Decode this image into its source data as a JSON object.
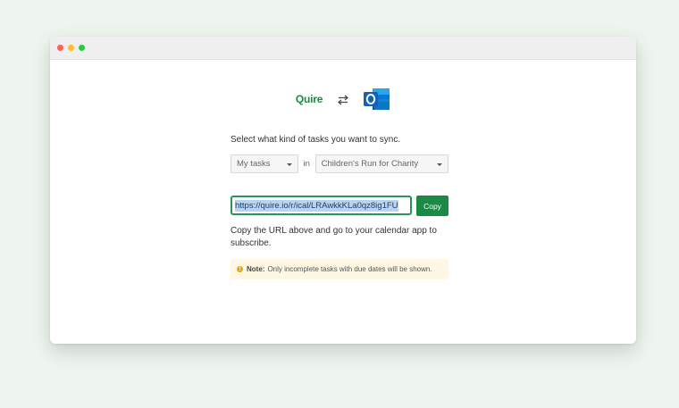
{
  "window": {
    "controls": [
      "close",
      "minimize",
      "maximize"
    ]
  },
  "logos": {
    "quire": "Quire",
    "swap_icon": "swap-arrows-icon",
    "outlook_icon": "outlook-icon"
  },
  "sync": {
    "prompt": "Select what kind of tasks you want to sync.",
    "task_filter": "My tasks",
    "in_label": "in",
    "project": "Children's Run for Charity"
  },
  "url": {
    "value": "https://quire.io/r/ical/LRAwkkKLa0qz8ig1FU",
    "copy_label": "Copy"
  },
  "instructions": "Copy the URL above and go to your calendar app to subscribe.",
  "note": {
    "icon": "info-icon",
    "label": "Note:",
    "text": "Only incomplete tasks with due dates will be shown."
  },
  "colors": {
    "brand_green": "#1b8a45",
    "background": "#eef4ee",
    "note_bg": "#fdf7e3"
  }
}
